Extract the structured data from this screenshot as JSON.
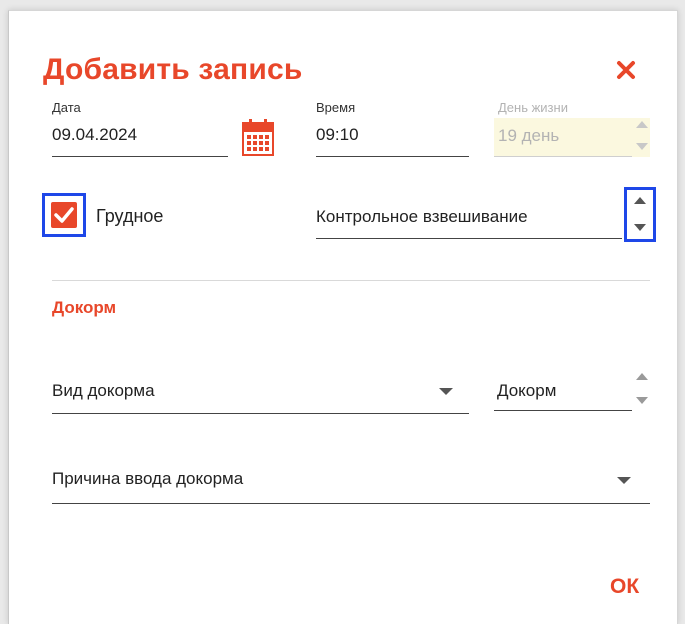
{
  "dialog": {
    "title": "Добавить запись",
    "close_icon": "close-icon",
    "accent_color": "#e8472a",
    "highlight_color": "#1e47e8"
  },
  "date": {
    "label": "Дата",
    "value": "09.04.2024",
    "icon": "calendar-icon"
  },
  "time": {
    "label": "Время",
    "value": "09:10"
  },
  "day_of_life": {
    "label": "День жизни",
    "value": "19 день"
  },
  "breast": {
    "label": "Грудное",
    "checked": true
  },
  "weighing": {
    "value": "Контрольное взвешивание"
  },
  "supplement": {
    "section_title": "Докорм",
    "type_placeholder": "Вид докорма",
    "amount_placeholder": "Докорм",
    "reason_placeholder": "Причина ввода докорма"
  },
  "actions": {
    "ok_label": "ОК"
  }
}
